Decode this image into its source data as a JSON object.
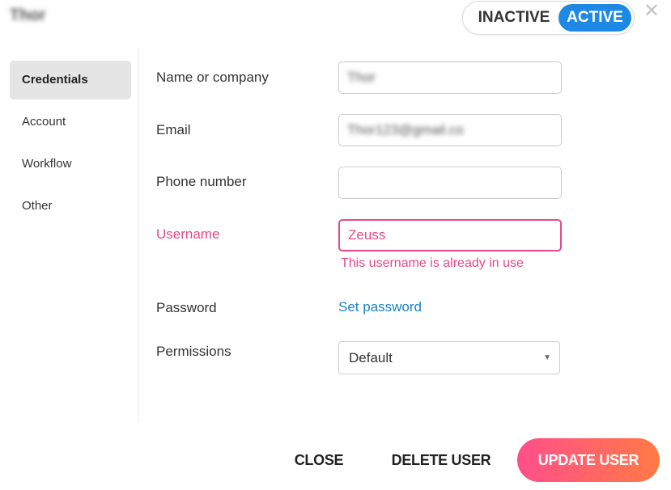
{
  "header": {
    "user_name": "Thor",
    "status_toggle": {
      "inactive_label": "INACTIVE",
      "active_label": "ACTIVE",
      "selected": "ACTIVE"
    },
    "close_icon": "close-icon"
  },
  "sidebar": {
    "items": [
      {
        "label": "Credentials",
        "active": true
      },
      {
        "label": "Account",
        "active": false
      },
      {
        "label": "Workflow",
        "active": false
      },
      {
        "label": "Other",
        "active": false
      }
    ]
  },
  "form": {
    "name": {
      "label": "Name or company",
      "value": "Thor"
    },
    "email": {
      "label": "Email",
      "value": "Thor123@gmail.co"
    },
    "phone": {
      "label": "Phone number",
      "value": ""
    },
    "username": {
      "label": "Username",
      "value": "Zeuss",
      "error": "This username is already in use"
    },
    "password": {
      "label": "Password",
      "link": "Set password"
    },
    "permissions": {
      "label": "Permissions",
      "selected": "Default"
    }
  },
  "footer": {
    "close_label": "CLOSE",
    "delete_label": "DELETE USER",
    "update_label": "UPDATE USER"
  },
  "colors": {
    "active_toggle": "#1e88e5",
    "error": "#e8488a",
    "link": "#1a82c4",
    "update_gradient_start": "#ff4f8b",
    "update_gradient_end": "#ff7a45"
  }
}
